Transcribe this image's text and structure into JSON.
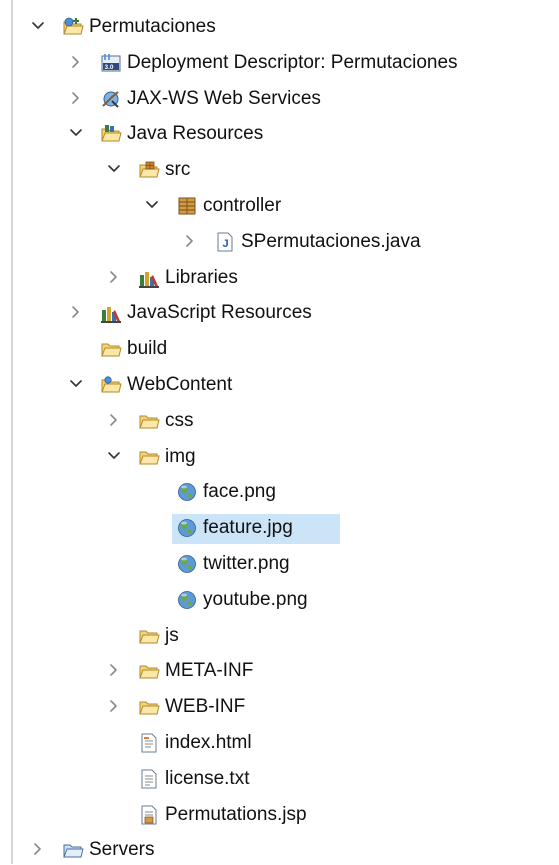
{
  "tree": {
    "items": [
      {
        "label": "Permutaciones",
        "depth": 0,
        "toggle": "expanded",
        "icon": "web-project-icon",
        "name": "project-permutaciones"
      },
      {
        "label": "Deployment Descriptor: Permutaciones",
        "depth": 1,
        "toggle": "collapsed",
        "icon": "deployment-descriptor-icon",
        "name": "deployment-descriptor"
      },
      {
        "label": "JAX-WS Web Services",
        "depth": 1,
        "toggle": "collapsed",
        "icon": "web-services-icon",
        "name": "jax-ws-web-services"
      },
      {
        "label": "Java Resources",
        "depth": 1,
        "toggle": "expanded",
        "icon": "java-resources-icon",
        "name": "java-resources"
      },
      {
        "label": "src",
        "depth": 2,
        "toggle": "expanded",
        "icon": "source-folder-icon",
        "name": "src-folder"
      },
      {
        "label": "controller",
        "depth": 3,
        "toggle": "expanded",
        "icon": "package-icon",
        "name": "controller-package"
      },
      {
        "label": "SPermutaciones.java",
        "depth": 4,
        "toggle": "collapsed",
        "icon": "java-file-icon",
        "name": "spermutaciones-java"
      },
      {
        "label": "Libraries",
        "depth": 2,
        "toggle": "collapsed",
        "icon": "libraries-icon",
        "name": "libraries"
      },
      {
        "label": "JavaScript Resources",
        "depth": 1,
        "toggle": "collapsed",
        "icon": "libraries-icon",
        "name": "javascript-resources"
      },
      {
        "label": "build",
        "depth": 1,
        "toggle": "none",
        "icon": "folder-icon",
        "name": "build-folder"
      },
      {
        "label": "WebContent",
        "depth": 1,
        "toggle": "expanded",
        "icon": "web-folder-icon",
        "name": "webcontent-folder"
      },
      {
        "label": "css",
        "depth": 2,
        "toggle": "collapsed",
        "icon": "folder-icon",
        "name": "css-folder"
      },
      {
        "label": "img",
        "depth": 2,
        "toggle": "expanded",
        "icon": "folder-icon",
        "name": "img-folder"
      },
      {
        "label": "face.png",
        "depth": 3,
        "toggle": "none",
        "icon": "globe-icon",
        "name": "face-png"
      },
      {
        "label": "feature.jpg",
        "depth": 3,
        "toggle": "none",
        "icon": "globe-icon",
        "name": "feature-jpg",
        "selected": true
      },
      {
        "label": "twitter.png",
        "depth": 3,
        "toggle": "none",
        "icon": "globe-icon",
        "name": "twitter-png"
      },
      {
        "label": "youtube.png",
        "depth": 3,
        "toggle": "none",
        "icon": "globe-icon",
        "name": "youtube-png"
      },
      {
        "label": "js",
        "depth": 2,
        "toggle": "none",
        "icon": "folder-icon",
        "name": "js-folder"
      },
      {
        "label": "META-INF",
        "depth": 2,
        "toggle": "collapsed",
        "icon": "folder-icon",
        "name": "meta-inf-folder"
      },
      {
        "label": "WEB-INF",
        "depth": 2,
        "toggle": "collapsed",
        "icon": "folder-icon",
        "name": "web-inf-folder"
      },
      {
        "label": "index.html",
        "depth": 2,
        "toggle": "none",
        "icon": "html-file-icon",
        "name": "index-html"
      },
      {
        "label": "license.txt",
        "depth": 2,
        "toggle": "none",
        "icon": "text-file-icon",
        "name": "license-txt"
      },
      {
        "label": "Permutations.jsp",
        "depth": 2,
        "toggle": "none",
        "icon": "jsp-file-icon",
        "name": "permutations-jsp"
      },
      {
        "label": "Servers",
        "depth": 0,
        "toggle": "collapsed",
        "icon": "servers-folder-icon",
        "name": "servers-project"
      }
    ]
  },
  "colors": {
    "selection": "#cce4f7",
    "folder": "#f5d376",
    "folder_outline": "#b3892b",
    "chevron": "#555555"
  }
}
